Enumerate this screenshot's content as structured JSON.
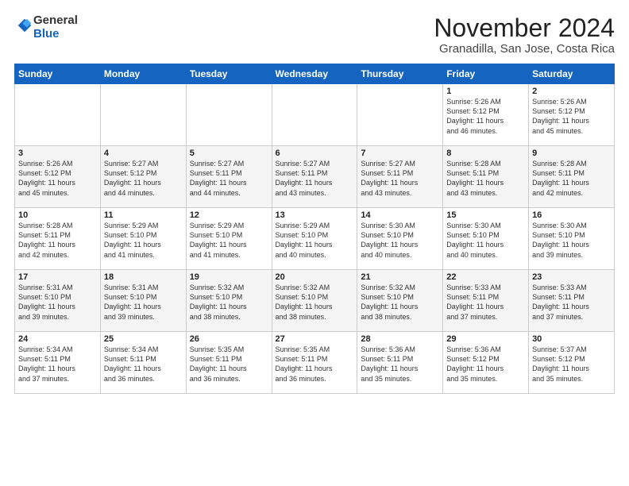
{
  "logo": {
    "general": "General",
    "blue": "Blue"
  },
  "title": "November 2024",
  "subtitle": "Granadilla, San Jose, Costa Rica",
  "days_of_week": [
    "Sunday",
    "Monday",
    "Tuesday",
    "Wednesday",
    "Thursday",
    "Friday",
    "Saturday"
  ],
  "weeks": [
    [
      {
        "day": "",
        "info": ""
      },
      {
        "day": "",
        "info": ""
      },
      {
        "day": "",
        "info": ""
      },
      {
        "day": "",
        "info": ""
      },
      {
        "day": "",
        "info": ""
      },
      {
        "day": "1",
        "info": "Sunrise: 5:26 AM\nSunset: 5:12 PM\nDaylight: 11 hours\nand 46 minutes."
      },
      {
        "day": "2",
        "info": "Sunrise: 5:26 AM\nSunset: 5:12 PM\nDaylight: 11 hours\nand 45 minutes."
      }
    ],
    [
      {
        "day": "3",
        "info": "Sunrise: 5:26 AM\nSunset: 5:12 PM\nDaylight: 11 hours\nand 45 minutes."
      },
      {
        "day": "4",
        "info": "Sunrise: 5:27 AM\nSunset: 5:12 PM\nDaylight: 11 hours\nand 44 minutes."
      },
      {
        "day": "5",
        "info": "Sunrise: 5:27 AM\nSunset: 5:11 PM\nDaylight: 11 hours\nand 44 minutes."
      },
      {
        "day": "6",
        "info": "Sunrise: 5:27 AM\nSunset: 5:11 PM\nDaylight: 11 hours\nand 43 minutes."
      },
      {
        "day": "7",
        "info": "Sunrise: 5:27 AM\nSunset: 5:11 PM\nDaylight: 11 hours\nand 43 minutes."
      },
      {
        "day": "8",
        "info": "Sunrise: 5:28 AM\nSunset: 5:11 PM\nDaylight: 11 hours\nand 43 minutes."
      },
      {
        "day": "9",
        "info": "Sunrise: 5:28 AM\nSunset: 5:11 PM\nDaylight: 11 hours\nand 42 minutes."
      }
    ],
    [
      {
        "day": "10",
        "info": "Sunrise: 5:28 AM\nSunset: 5:11 PM\nDaylight: 11 hours\nand 42 minutes."
      },
      {
        "day": "11",
        "info": "Sunrise: 5:29 AM\nSunset: 5:10 PM\nDaylight: 11 hours\nand 41 minutes."
      },
      {
        "day": "12",
        "info": "Sunrise: 5:29 AM\nSunset: 5:10 PM\nDaylight: 11 hours\nand 41 minutes."
      },
      {
        "day": "13",
        "info": "Sunrise: 5:29 AM\nSunset: 5:10 PM\nDaylight: 11 hours\nand 40 minutes."
      },
      {
        "day": "14",
        "info": "Sunrise: 5:30 AM\nSunset: 5:10 PM\nDaylight: 11 hours\nand 40 minutes."
      },
      {
        "day": "15",
        "info": "Sunrise: 5:30 AM\nSunset: 5:10 PM\nDaylight: 11 hours\nand 40 minutes."
      },
      {
        "day": "16",
        "info": "Sunrise: 5:30 AM\nSunset: 5:10 PM\nDaylight: 11 hours\nand 39 minutes."
      }
    ],
    [
      {
        "day": "17",
        "info": "Sunrise: 5:31 AM\nSunset: 5:10 PM\nDaylight: 11 hours\nand 39 minutes."
      },
      {
        "day": "18",
        "info": "Sunrise: 5:31 AM\nSunset: 5:10 PM\nDaylight: 11 hours\nand 39 minutes."
      },
      {
        "day": "19",
        "info": "Sunrise: 5:32 AM\nSunset: 5:10 PM\nDaylight: 11 hours\nand 38 minutes."
      },
      {
        "day": "20",
        "info": "Sunrise: 5:32 AM\nSunset: 5:10 PM\nDaylight: 11 hours\nand 38 minutes."
      },
      {
        "day": "21",
        "info": "Sunrise: 5:32 AM\nSunset: 5:10 PM\nDaylight: 11 hours\nand 38 minutes."
      },
      {
        "day": "22",
        "info": "Sunrise: 5:33 AM\nSunset: 5:11 PM\nDaylight: 11 hours\nand 37 minutes."
      },
      {
        "day": "23",
        "info": "Sunrise: 5:33 AM\nSunset: 5:11 PM\nDaylight: 11 hours\nand 37 minutes."
      }
    ],
    [
      {
        "day": "24",
        "info": "Sunrise: 5:34 AM\nSunset: 5:11 PM\nDaylight: 11 hours\nand 37 minutes."
      },
      {
        "day": "25",
        "info": "Sunrise: 5:34 AM\nSunset: 5:11 PM\nDaylight: 11 hours\nand 36 minutes."
      },
      {
        "day": "26",
        "info": "Sunrise: 5:35 AM\nSunset: 5:11 PM\nDaylight: 11 hours\nand 36 minutes."
      },
      {
        "day": "27",
        "info": "Sunrise: 5:35 AM\nSunset: 5:11 PM\nDaylight: 11 hours\nand 36 minutes."
      },
      {
        "day": "28",
        "info": "Sunrise: 5:36 AM\nSunset: 5:11 PM\nDaylight: 11 hours\nand 35 minutes."
      },
      {
        "day": "29",
        "info": "Sunrise: 5:36 AM\nSunset: 5:12 PM\nDaylight: 11 hours\nand 35 minutes."
      },
      {
        "day": "30",
        "info": "Sunrise: 5:37 AM\nSunset: 5:12 PM\nDaylight: 11 hours\nand 35 minutes."
      }
    ]
  ]
}
